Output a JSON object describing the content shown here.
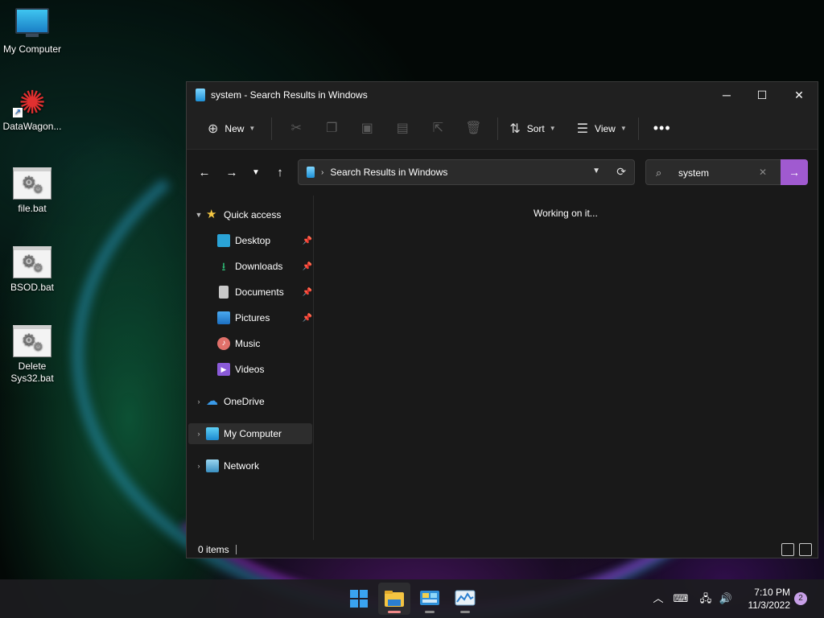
{
  "desktop": {
    "icons": [
      {
        "label": "My Computer",
        "icon": "monitor-icon"
      },
      {
        "label": "DataWagon...",
        "icon": "app-shortcut-icon"
      },
      {
        "label": "file.bat",
        "icon": "batch-file-icon"
      },
      {
        "label": "BSOD.bat",
        "icon": "batch-file-icon"
      },
      {
        "label": "Delete Sys32.bat",
        "icon": "batch-file-icon"
      }
    ]
  },
  "window": {
    "title": "system - Search Results in Windows",
    "toolbar": {
      "new_label": "New",
      "sort_label": "Sort",
      "view_label": "View"
    },
    "address": {
      "path": "Search Results in Windows"
    },
    "search": {
      "value": "system"
    },
    "nav": {
      "quick_access": "Quick access",
      "items": [
        {
          "label": "Desktop",
          "pinned": true
        },
        {
          "label": "Downloads",
          "pinned": true
        },
        {
          "label": "Documents",
          "pinned": true
        },
        {
          "label": "Pictures",
          "pinned": true
        },
        {
          "label": "Music",
          "pinned": false
        },
        {
          "label": "Videos",
          "pinned": false
        }
      ],
      "onedrive": "OneDrive",
      "my_computer": "My Computer",
      "network": "Network"
    },
    "content_message": "Working on it...",
    "status": {
      "item_count": "0 items"
    }
  },
  "taskbar": {
    "apps": [
      "start",
      "file-explorer",
      "control-panel",
      "task-manager"
    ],
    "clock": {
      "time": "7:10 PM",
      "date": "11/3/2022"
    },
    "notification_count": "2"
  },
  "colors": {
    "accent": "#a05ad0",
    "window_bg": "#191919",
    "titlebar_bg": "#202020"
  }
}
